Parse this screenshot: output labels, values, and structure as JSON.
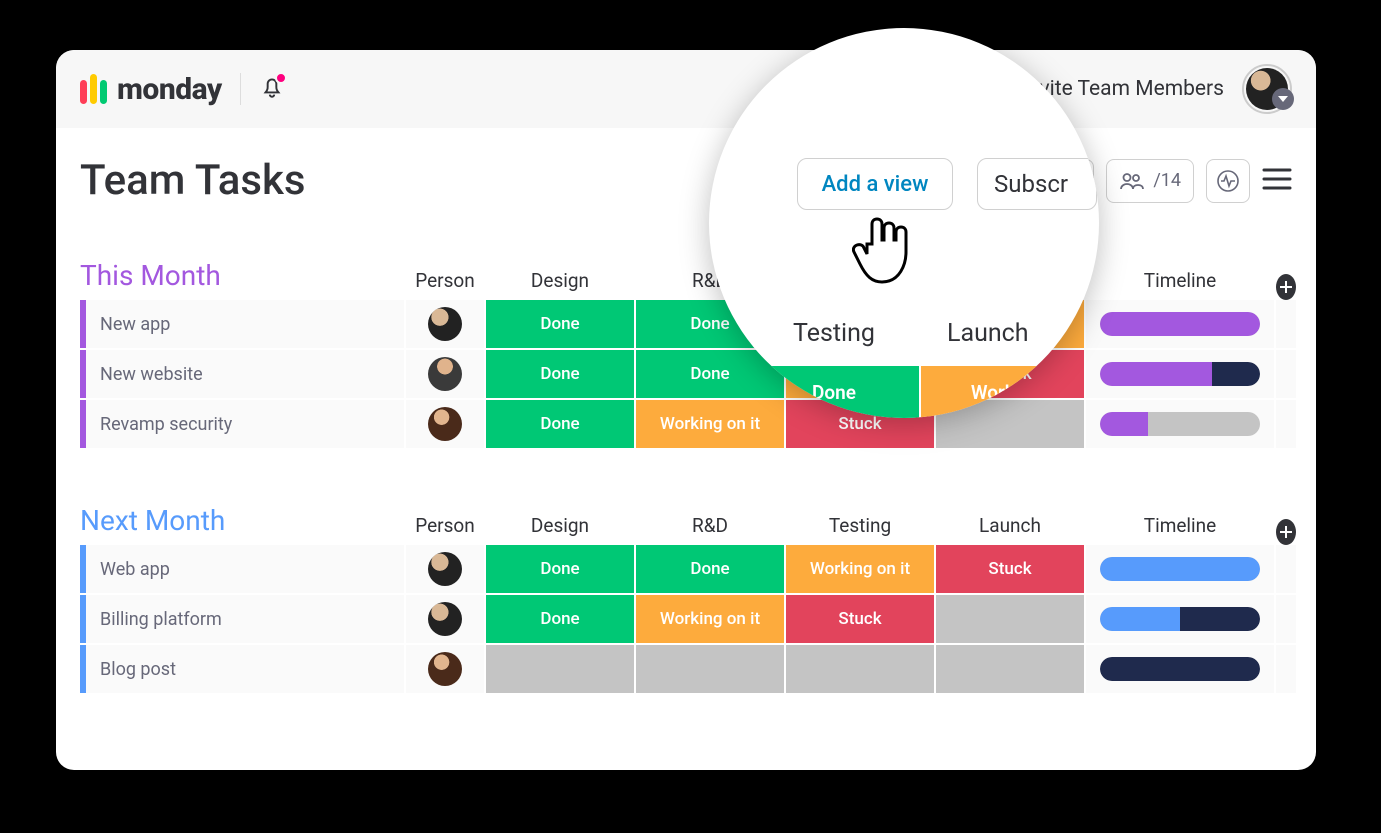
{
  "brand": "monday",
  "header": {
    "invite_label": "Invite Team Members"
  },
  "page": {
    "title": "Team Tasks",
    "add_view": "Add a view",
    "subscribe": "Subscribe",
    "subscribers_count": "/14"
  },
  "columns": {
    "person": "Person",
    "design": "Design",
    "rnd": "R&D",
    "testing": "Testing",
    "launch": "Launch",
    "timeline": "Timeline"
  },
  "status_labels": {
    "done": "Done",
    "working": "Working on it",
    "stuck": "Stuck"
  },
  "groups": [
    {
      "title": "This Month",
      "color": "purple",
      "rows": [
        {
          "name": "New app",
          "avatar": "av1",
          "statuses": [
            "done",
            "done",
            "done",
            "work"
          ],
          "timeline": [
            {
              "from": 0,
              "to": 100,
              "color": "#a358df"
            }
          ]
        },
        {
          "name": "New website",
          "avatar": "av2",
          "statuses": [
            "done",
            "done",
            "work",
            "stuck"
          ],
          "timeline": [
            {
              "from": 0,
              "to": 70,
              "color": "#a358df"
            },
            {
              "from": 70,
              "to": 100,
              "color": "#1f2a4d"
            }
          ]
        },
        {
          "name": "Revamp security",
          "avatar": "av3",
          "statuses": [
            "done",
            "work",
            "stuck",
            "empty"
          ],
          "timeline": [
            {
              "from": 0,
              "to": 30,
              "color": "#a358df"
            }
          ]
        }
      ]
    },
    {
      "title": "Next Month",
      "color": "blue",
      "rows": [
        {
          "name": "Web app",
          "avatar": "av1",
          "statuses": [
            "done",
            "done",
            "work",
            "stuck"
          ],
          "timeline": [
            {
              "from": 0,
              "to": 100,
              "color": "#579bfc"
            }
          ]
        },
        {
          "name": "Billing platform",
          "avatar": "av1",
          "statuses": [
            "done",
            "work",
            "stuck",
            "empty"
          ],
          "timeline": [
            {
              "from": 0,
              "to": 50,
              "color": "#579bfc"
            },
            {
              "from": 50,
              "to": 100,
              "color": "#1f2a4d"
            }
          ]
        },
        {
          "name": "Blog post",
          "avatar": "av3",
          "statuses": [
            "empty",
            "empty",
            "empty",
            "empty"
          ],
          "timeline": [
            {
              "from": 0,
              "to": 100,
              "color": "#1f2a4d"
            }
          ]
        }
      ]
    }
  ],
  "magnifier": {
    "add_view": "Add a view",
    "subscribe": "Subscr",
    "testing": "Testing",
    "launch": "Launch",
    "done": "Done",
    "working": "Working"
  }
}
